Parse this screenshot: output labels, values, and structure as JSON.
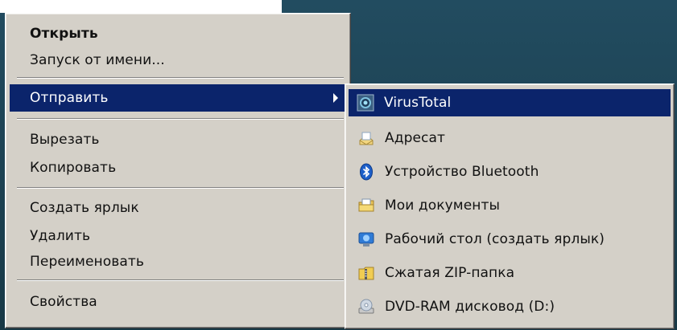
{
  "context_menu": {
    "items": [
      {
        "label": "Открыть",
        "bold": true
      },
      {
        "label": "Запуск от имени..."
      },
      {
        "label": "Отправить",
        "submenu": true,
        "selected": true
      },
      {
        "label": "Вырезать"
      },
      {
        "label": "Копировать"
      },
      {
        "label": "Создать ярлык"
      },
      {
        "label": "Удалить"
      },
      {
        "label": "Переименовать"
      },
      {
        "label": "Свойства"
      }
    ]
  },
  "send_to_menu": {
    "items": [
      {
        "label": "VirusTotal",
        "icon": "virustotal-icon",
        "selected": true
      },
      {
        "label": "Адресат",
        "icon": "mail-recipient-icon"
      },
      {
        "label": "Устройство Bluetooth",
        "icon": "bluetooth-icon"
      },
      {
        "label": "Мои документы",
        "icon": "my-documents-icon"
      },
      {
        "label": "Рабочий стол (создать ярлык)",
        "icon": "desktop-shortcut-icon"
      },
      {
        "label": "Сжатая ZIP-папка",
        "icon": "zip-folder-icon"
      },
      {
        "label": "DVD-RAM дисковод (D:)",
        "icon": "dvd-drive-icon"
      }
    ]
  },
  "colors": {
    "menu_bg": "#d4d0c8",
    "highlight": "#0b246b",
    "desktop_bg": "#1b3f51"
  }
}
